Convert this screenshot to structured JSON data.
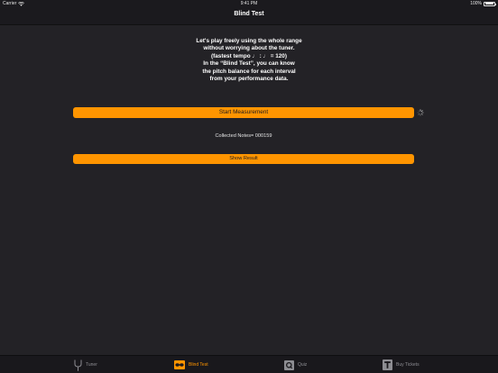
{
  "status_bar": {
    "carrier": "Carrier",
    "time": "9:41 PM",
    "battery": "100%",
    "battery_level": 1.0
  },
  "nav": {
    "title": "Blind Test"
  },
  "intro": {
    "lines": [
      "Let's play freely using the whole range",
      "without worrying about the tuner.",
      "(fastest tempo ♩ : ♩ = 120)",
      "In the “Blind Test”, you can know",
      "the pitch balance for each interval",
      "from your performance data."
    ]
  },
  "actions": {
    "start_label": "Start Measurement",
    "collected_text": "Collected Notes= 000159",
    "result_label": "Show Result"
  },
  "tabs": [
    {
      "label": "Tuner",
      "icon": "tuning-fork-icon",
      "active": false
    },
    {
      "label": "Blind Test",
      "icon": "blindfold-icon",
      "active": true
    },
    {
      "label": "Quiz",
      "icon": "quiz-icon",
      "active": false
    },
    {
      "label": "Buy Tickets",
      "icon": "ticket-icon",
      "active": false
    }
  ],
  "colors": {
    "accent": "#ff9500",
    "background": "#232226",
    "bar": "#1b1a1e",
    "inactive_tab": "#8d8d92"
  }
}
